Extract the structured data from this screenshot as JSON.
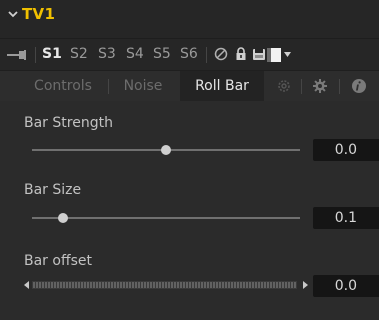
{
  "node": {
    "title": "TV1"
  },
  "toolbar": {
    "versions": [
      "S1",
      "S2",
      "S3",
      "S4",
      "S5",
      "S6"
    ],
    "active_version": "S1"
  },
  "tabs": [
    {
      "label": "Controls",
      "active": false
    },
    {
      "label": "Noise",
      "active": false
    },
    {
      "label": "Roll Bar",
      "active": true
    }
  ],
  "controls": {
    "bar_strength": {
      "label": "Bar Strength",
      "value": "0.0",
      "position": 0.5
    },
    "bar_size": {
      "label": "Bar Size",
      "value": "0.1",
      "position": 0.1
    },
    "bar_offset": {
      "label": "Bar offset",
      "value": "0.0"
    }
  },
  "colors": {
    "title": "#f0c000",
    "panel_bg": "#2b2b2b",
    "value_bg": "#151515"
  },
  "icons": [
    "chevron-down-icon",
    "pin-icon",
    "disable-icon",
    "lock-icon",
    "cache-icon",
    "color-swatch-icon",
    "settings-icon",
    "gear-icon",
    "info-icon"
  ]
}
